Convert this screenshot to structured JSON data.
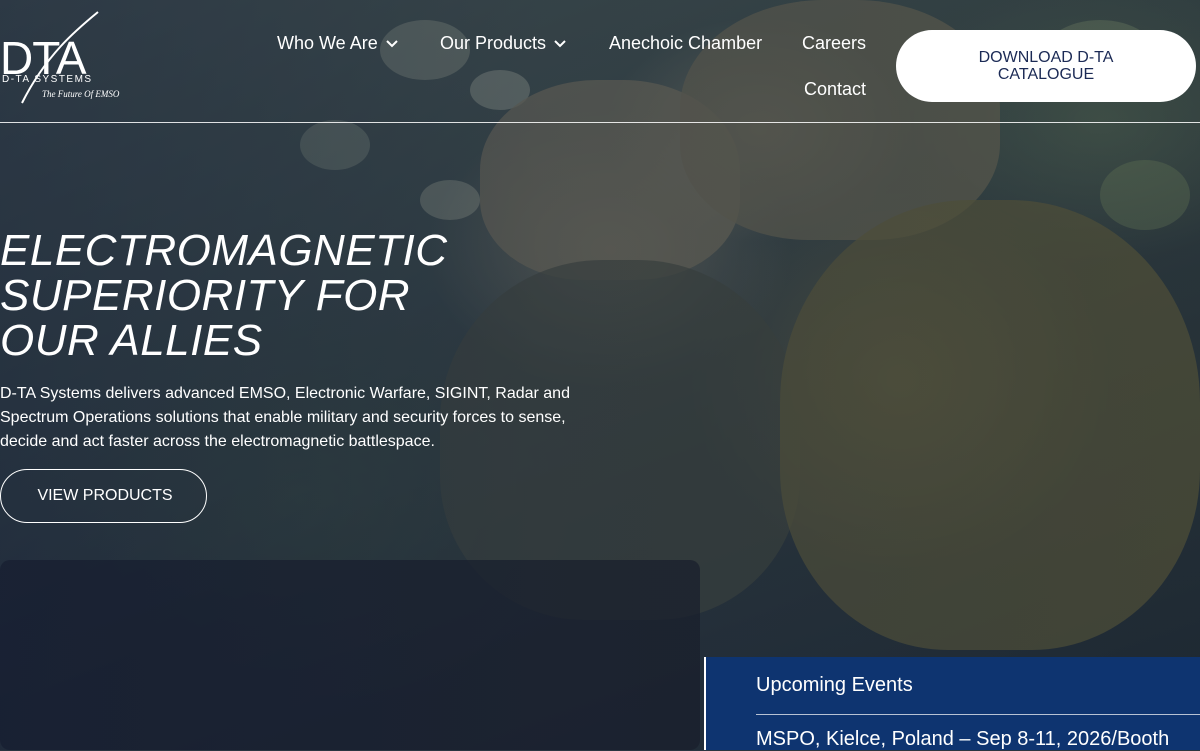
{
  "brand": {
    "logo_text": "DTA",
    "company_name": "D-TA SYSTEMS",
    "tagline": "The Future Of EMSO"
  },
  "nav": {
    "items": [
      {
        "label": "Who We Are",
        "has_dropdown": true
      },
      {
        "label": "Our Products",
        "has_dropdown": true
      },
      {
        "label": "Anechoic Chamber",
        "has_dropdown": false
      },
      {
        "label": "Careers",
        "has_dropdown": false
      },
      {
        "label": "Contact",
        "has_dropdown": false
      }
    ],
    "cta_label": "DOWNLOAD D-TA CATALOGUE",
    "dropdown_icon": "chevron-down-icon"
  },
  "hero": {
    "title_lines": [
      "ELECTROMAGNETIC",
      "SUPERIORITY FOR",
      "OUR ALLIES"
    ],
    "description": "D-TA Systems delivers advanced EMSO,  Electronic Warfare, SIGINT, Radar and\nSpectrum  Operations solutions that enable military and  security forces to sense,\ndecide and act faster across the electromagnetic battlespace.",
    "button_label": "VIEW PRODUCTS"
  },
  "events": {
    "title": "Upcoming Events",
    "items": [
      "MSPO, Kielce, Poland – Sep 8-11, 2026/Booth"
    ]
  },
  "colors": {
    "cta_bg": "#ffffff",
    "cta_text": "#1b2a55",
    "events_bg": "#0e3470",
    "text": "#ffffff"
  }
}
